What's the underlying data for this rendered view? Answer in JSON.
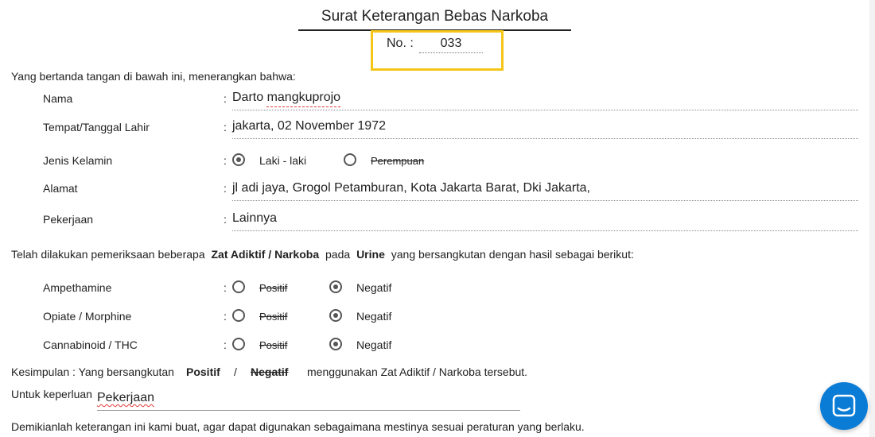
{
  "title": "Surat Keterangan Bebas Narkoba",
  "number": {
    "label": "No. :",
    "value": "033"
  },
  "intro": "Yang bertanda tangan di bawah ini, menerangkan bahwa:",
  "fields": {
    "nama": {
      "label": "Nama",
      "value": "Darto mangkuprojo"
    },
    "ttl": {
      "label": "Tempat/Tanggal Lahir",
      "value": "jakarta, 02 November 1972"
    },
    "jenis_kelamin": {
      "label": "Jenis Kelamin",
      "option1": "Laki - laki",
      "option2": "Perempuan",
      "selected": "Laki - laki"
    },
    "alamat": {
      "label": "Alamat",
      "value": "jl adi jaya, Grogol Petamburan, Kota Jakarta Barat, Dki Jakarta,"
    },
    "pekerjaan": {
      "label": "Pekerjaan",
      "value": "Lainnya"
    }
  },
  "colon": ":",
  "exam": {
    "prefix": "Telah dilakukan pemeriksaan beberapa",
    "bold1": "Zat Adiktif / Narkoba",
    "mid": "pada",
    "bold2": "Urine",
    "suffix": "yang bersangkutan dengan hasil sebagai berikut:"
  },
  "tests": [
    {
      "label": "Ampethamine",
      "positive": "Positif",
      "negative": "Negatif",
      "selected": "Negatif"
    },
    {
      "label": "Opiate / Morphine",
      "positive": "Positif",
      "negative": "Negatif",
      "selected": "Negatif"
    },
    {
      "label": "Cannabinoid / THC",
      "positive": "Positif",
      "negative": "Negatif",
      "selected": "Negatif"
    }
  ],
  "conclusion": {
    "prefix": "Kesimpulan : Yang bersangkutan",
    "positive": "Positif",
    "slash": "/",
    "negative": "Negatif",
    "suffix": "menggunakan Zat Adiktif / Narkoba tersebut."
  },
  "purpose": {
    "label": "Untuk keperluan",
    "value": "Pekerjaan"
  },
  "closing": "Demikianlah keterangan ini kami buat, agar dapat digunakan sebagaimana mestinya sesuai peraturan yang berlaku.",
  "chat": {
    "icon": "chat-icon",
    "color": "#0a7cd6"
  },
  "colors": {
    "highlight": "#f5c518",
    "spellcheck": "#e53935"
  }
}
